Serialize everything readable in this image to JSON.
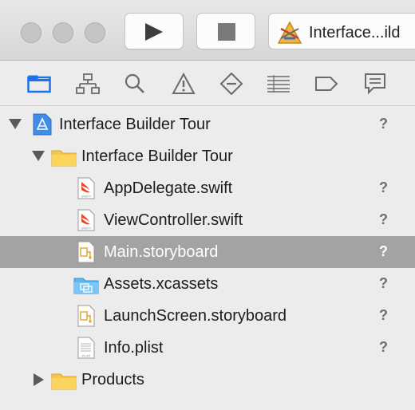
{
  "toolbar": {
    "scheme_label": "Interface...ild"
  },
  "navigator": {
    "tabs": [
      {
        "name": "project-navigator-icon",
        "active": true
      },
      {
        "name": "symbol-navigator-icon"
      },
      {
        "name": "find-navigator-icon"
      },
      {
        "name": "issue-navigator-icon"
      },
      {
        "name": "test-navigator-icon"
      },
      {
        "name": "debug-navigator-icon"
      },
      {
        "name": "breakpoint-navigator-icon"
      },
      {
        "name": "report-navigator-icon"
      }
    ]
  },
  "tree": {
    "items": [
      {
        "label": "Interface Builder Tour",
        "status": "?",
        "icon": "xcode-project-icon"
      },
      {
        "label": "Interface Builder Tour",
        "status": "",
        "icon": "folder-icon"
      },
      {
        "label": "AppDelegate.swift",
        "status": "?",
        "icon": "swift-file-icon"
      },
      {
        "label": "ViewController.swift",
        "status": "?",
        "icon": "swift-file-icon"
      },
      {
        "label": "Main.storyboard",
        "status": "?",
        "icon": "storyboard-file-icon"
      },
      {
        "label": "Assets.xcassets",
        "status": "?",
        "icon": "asset-catalog-icon"
      },
      {
        "label": "LaunchScreen.storyboard",
        "status": "?",
        "icon": "storyboard-file-icon"
      },
      {
        "label": "Info.plist",
        "status": "?",
        "icon": "plist-file-icon"
      },
      {
        "label": "Products",
        "status": "",
        "icon": "folder-icon"
      }
    ],
    "selected_index": 4
  },
  "colors": {
    "selection": "#a3a3a3",
    "accent": "#1a73e8",
    "folder": "#f7c74a"
  }
}
